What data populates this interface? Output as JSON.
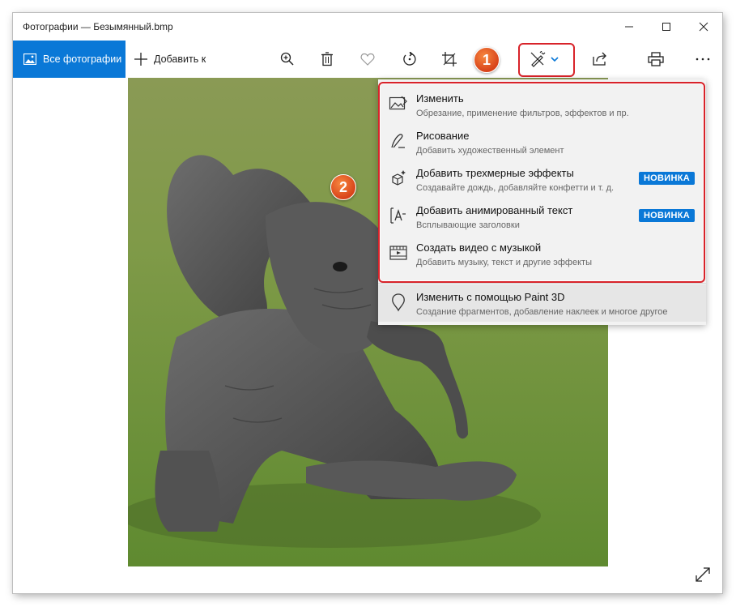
{
  "window": {
    "title": "Фотографии — Безымянный.bmp"
  },
  "toolbar": {
    "all_photos_label": "Все фотографии",
    "add_to_label": "Добавить к",
    "icons": [
      "zoom-icon",
      "delete-icon",
      "favorite-icon",
      "rotate-icon",
      "crop-icon",
      "edit-create-icon",
      "share-icon",
      "print-icon",
      "more-icon"
    ]
  },
  "annotations": {
    "badge1": "1",
    "badge2": "2",
    "highlight_color": "#d8232a",
    "badge_color": "#e2551f"
  },
  "menu": {
    "items": [
      {
        "title": "Изменить",
        "subtitle": "Обрезание, применение фильтров, эффектов и пр.",
        "icon": "edit-photo-icon",
        "badge": ""
      },
      {
        "title": "Рисование",
        "subtitle": "Добавить художественный элемент",
        "icon": "draw-icon",
        "badge": ""
      },
      {
        "title": "Добавить трехмерные эффекты",
        "subtitle": "Создавайте дождь, добавляйте конфетти и т. д.",
        "icon": "3d-effects-icon",
        "badge": "НОВИНКА"
      },
      {
        "title": "Добавить анимированный текст",
        "subtitle": "Всплывающие заголовки",
        "icon": "animated-text-icon",
        "badge": "НОВИНКА"
      },
      {
        "title": "Создать видео с музыкой",
        "subtitle": "Добавить музыку, текст и другие эффекты",
        "icon": "video-icon",
        "badge": ""
      },
      {
        "title": "Изменить с помощью Paint 3D",
        "subtitle": "Создание фрагментов, добавление наклеек и многое другое",
        "icon": "paint3d-icon",
        "badge": ""
      }
    ]
  },
  "colors": {
    "accent": "#0a78d7"
  }
}
